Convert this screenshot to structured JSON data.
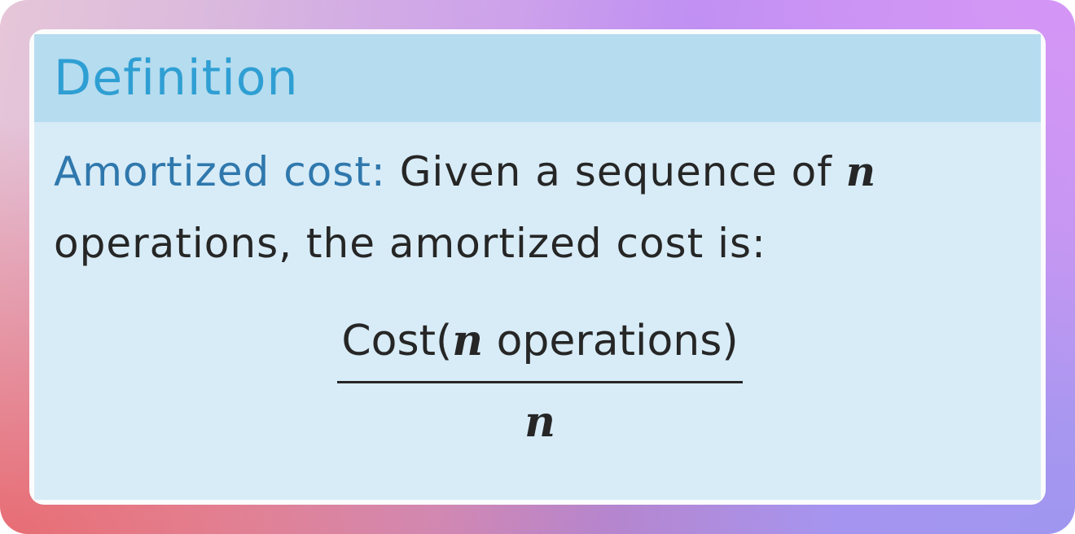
{
  "definition": {
    "title": "Definition",
    "term": "Amortized cost:",
    "line1_text": "Given a sequence of",
    "variable": "n",
    "line2_text": "operations, the amortized cost is:",
    "formula": {
      "numerator_prefix": "Cost(",
      "numerator_var": "n",
      "numerator_suffix": " operations)",
      "denominator": "n"
    }
  },
  "colors": {
    "title": "#2f9fd3",
    "term": "#2f78ad",
    "header_bg": "#b6dcef",
    "body_bg": "#d8ecf7"
  }
}
